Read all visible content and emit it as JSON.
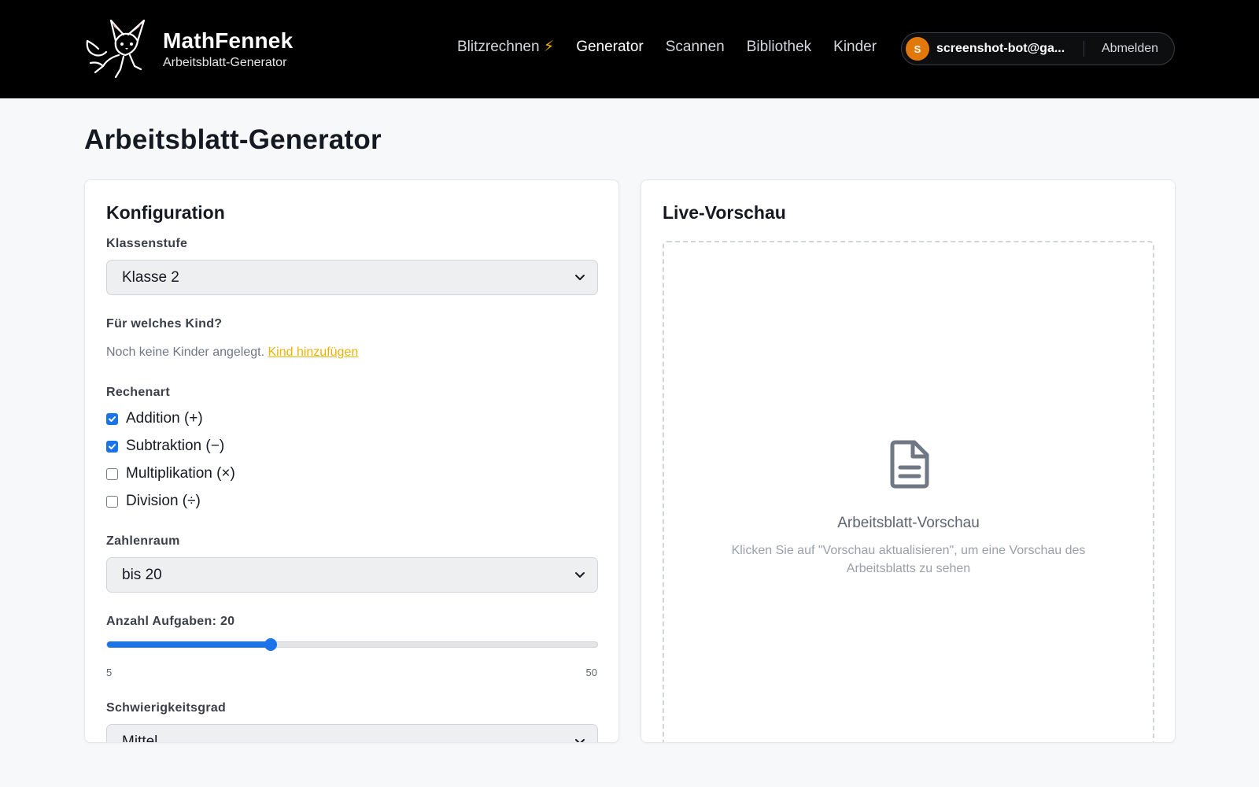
{
  "header": {
    "brand_name": "MathFennek",
    "brand_sub": "Arbeitsblatt-Generator",
    "nav": [
      {
        "label": "Blitzrechnen",
        "extra": "⚡"
      },
      {
        "label": "Generator"
      },
      {
        "label": "Scannen"
      },
      {
        "label": "Bibliothek"
      },
      {
        "label": "Kinder"
      }
    ],
    "user": {
      "avatar_initial": "S",
      "email": "screenshot-bot@ga...",
      "logout_label": "Abmelden"
    }
  },
  "page": {
    "title": "Arbeitsblatt-Generator"
  },
  "config": {
    "title": "Konfiguration",
    "grade_label": "Klassenstufe",
    "grade_value": "Klasse 2",
    "child_label": "Für welches Kind?",
    "child_empty": "Noch keine Kinder angelegt.",
    "child_add_link": "Kind hinzufügen",
    "operation_label": "Rechenart",
    "operations": [
      {
        "label": "Addition (+)",
        "checked": true
      },
      {
        "label": "Subtraktion (−)",
        "checked": true
      },
      {
        "label": "Multiplikation (×)",
        "checked": false
      },
      {
        "label": "Division (÷)",
        "checked": false
      }
    ],
    "range_label": "Zahlenraum",
    "range_value": "bis 20",
    "count_label": "Anzahl Aufgaben: 20",
    "count": {
      "min": 5,
      "max": 50,
      "value": 20,
      "min_label": "5",
      "max_label": "50"
    },
    "difficulty_label": "Schwierigkeitsgrad",
    "difficulty_value": "Mittel"
  },
  "preview": {
    "title": "Live-Vorschau",
    "placeholder_title": "Arbeitsblatt-Vorschau",
    "placeholder_text": "Klicken Sie auf \"Vorschau aktualisieren\", um eine Vorschau des Arbeitsblatts zu sehen"
  },
  "colors": {
    "accent": "#1a73e8",
    "link": "#eab308",
    "avatar": "#e2780a",
    "header_bg": "#000000"
  }
}
